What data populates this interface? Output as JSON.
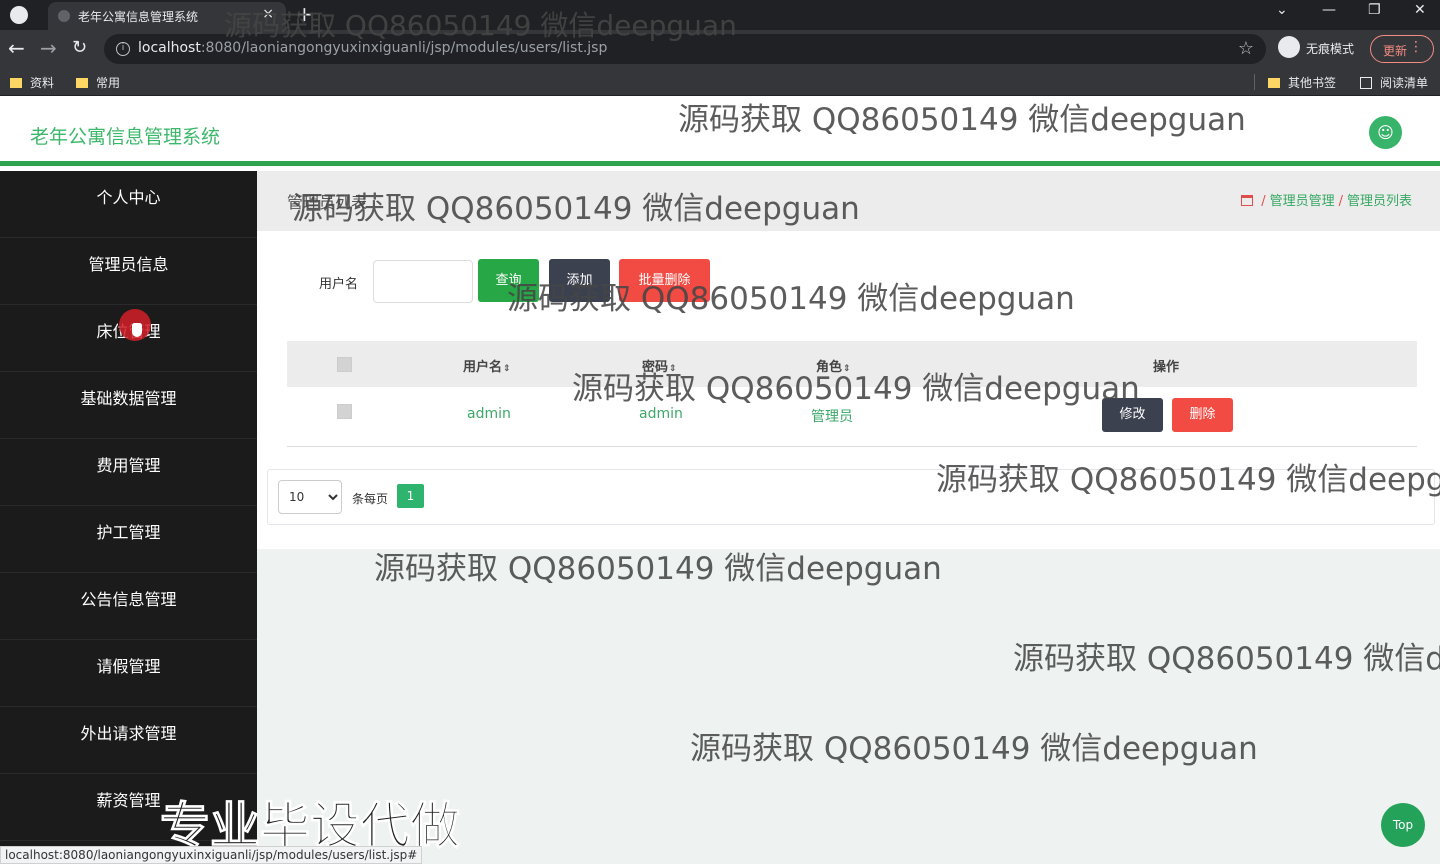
{
  "browser": {
    "tab_title": "老年公寓信息管理系统",
    "tab_close": "×",
    "new_tab": "+",
    "window_controls": [
      "⌄",
      "—",
      "❐",
      "✕"
    ],
    "url_host": "localhost",
    "url_path": ":8080/laoniangongyuxinxiguanli/jsp/modules/users/list.jsp",
    "incognito_label": "无痕模式",
    "update_label": "更新",
    "bookmarks": [
      "资料",
      "常用"
    ],
    "other_bookmarks": "其他书签",
    "reading_list": "阅读清单",
    "status_url": "localhost:8080/laoniangongyuxinxiguanli/jsp/modules/users/list.jsp#"
  },
  "app": {
    "title": "老年公寓信息管理系统"
  },
  "sidebar": {
    "items": [
      "个人中心",
      "管理员信息",
      "床位管理",
      "基础数据管理",
      "费用管理",
      "护工管理",
      "公告信息管理",
      "请假管理",
      "外出请求管理",
      "薪资管理"
    ]
  },
  "main": {
    "page_heading": "管理员列表",
    "breadcrumb": [
      "管理员管理",
      "管理员列表"
    ],
    "search": {
      "label": "用户名",
      "value": "",
      "buttons": {
        "search": "查询",
        "add": "添加",
        "batch_delete": "批量删除"
      }
    },
    "table": {
      "headers": [
        "用户名",
        "密码",
        "角色",
        "操作"
      ],
      "rows": [
        {
          "username": "admin",
          "password": "admin",
          "role": "管理员",
          "edit": "修改",
          "delete": "删除"
        }
      ]
    },
    "pagination": {
      "page_size": "10",
      "page_size_label": "条每页",
      "current_page": "1"
    }
  },
  "overlay": {
    "watermark": "源码获取 QQ86050149 微信deepguan",
    "promo": "专业毕设代做",
    "top_button": "Top"
  },
  "colors": {
    "accent_green": "#2ea44f",
    "sidebar_bg": "#1b1b1b",
    "danger": "#f24b43",
    "dark_button": "#3c4150"
  }
}
